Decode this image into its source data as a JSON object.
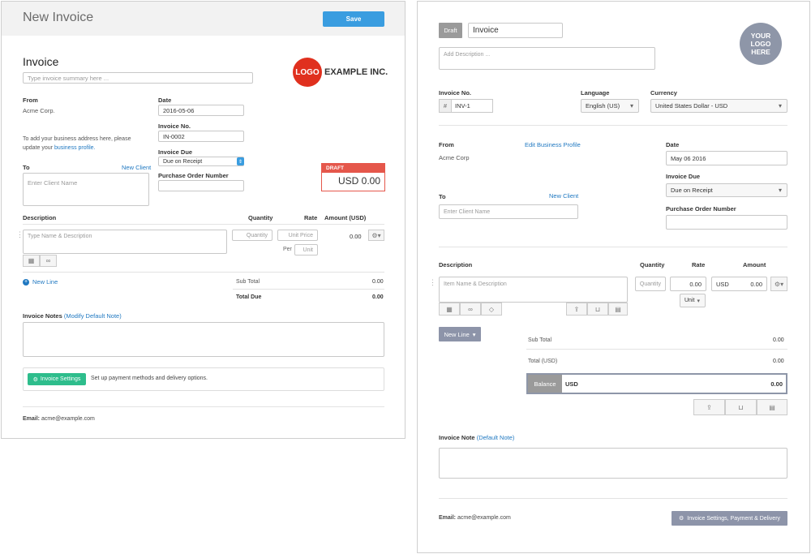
{
  "left": {
    "header_title": "New Invoice",
    "save_label": "Save",
    "invoice_title": "Invoice",
    "summary_placeholder": "Type invoice summary here ...",
    "logo_text": "LOGO",
    "company_name": "EXAMPLE INC.",
    "from_label": "From",
    "from_value": "Acme Corp.",
    "address_note_1": "To add your business address here, please",
    "address_note_2": "update your",
    "business_profile_link": "business profile.",
    "date_label": "Date",
    "date_value": "2016-05-06",
    "invoice_no_label": "Invoice No.",
    "invoice_no_value": "IN-0002",
    "invoice_due_label": "Invoice Due",
    "invoice_due_value": "Due on Receipt",
    "po_label": "Purchase Order Number",
    "to_label": "To",
    "new_client_link": "New Client",
    "client_placeholder": "Enter Client Name",
    "status_badge": "DRAFT",
    "status_amount": "USD 0.00",
    "col_description": "Description",
    "col_quantity": "Quantity",
    "col_rate": "Rate",
    "col_amount": "Amount (USD)",
    "item_placeholder": "Type Name & Description",
    "qty_placeholder": "Quantity",
    "price_placeholder": "Unit Price",
    "per_label": "Per",
    "unit_placeholder": "Unit",
    "line_amount": "0.00",
    "new_line_label": "New Line",
    "subtotal_label": "Sub Total",
    "subtotal_value": "0.00",
    "total_due_label": "Total Due",
    "total_due_value": "0.00",
    "notes_label": "Invoice Notes",
    "modify_note_link": "Modify Default Note",
    "settings_button": "Invoice Settings",
    "settings_desc": "Set up payment methods and delivery options.",
    "email_label": "Email:",
    "email_value": "acme@example.com"
  },
  "right": {
    "draft_badge": "Draft",
    "title_value": "Invoice",
    "description_placeholder": "Add Description ...",
    "logo_text": "YOUR LOGO HERE",
    "invoice_no_label": "Invoice No.",
    "invoice_no_prefix": "#",
    "invoice_no_value": "INV-1",
    "language_label": "Language",
    "language_value": "English (US)",
    "currency_label": "Currency",
    "currency_value": "United States Dollar - USD",
    "from_label": "From",
    "from_value": "Acme Corp",
    "edit_profile_link": "Edit Business Profile",
    "date_label": "Date",
    "date_value": "May 06 2016",
    "invoice_due_label": "Invoice Due",
    "invoice_due_value": "Due on Receipt",
    "po_label": "Purchase Order Number",
    "to_label": "To",
    "new_client_link": "New Client",
    "client_placeholder": "Enter Client Name",
    "col_description": "Description",
    "col_quantity": "Quantity",
    "col_rate": "Rate",
    "col_amount": "Amount",
    "item_placeholder": "Item Name & Description",
    "qty_placeholder": "Quantity",
    "rate_value": "0.00",
    "amount_currency": "USD",
    "amount_value": "0.00",
    "unit_label": "Unit",
    "new_line_label": "New Line",
    "subtotal_label": "Sub Total",
    "subtotal_value": "0.00",
    "total_label": "Total (USD)",
    "total_value": "0.00",
    "balance_label": "Balance",
    "balance_currency": "USD",
    "balance_value": "0.00",
    "note_label": "Invoice Note",
    "default_note_link": "Default Note",
    "email_label": "Email:",
    "email_value": "acme@example.com",
    "settings_button": "Invoice Settings, Payment & Delivery"
  },
  "colors": {
    "save_blue": "#3a9de0",
    "logo_red": "#e0301e",
    "draft_red": "#e5574b",
    "settings_green": "#2ebd8c",
    "right_button_gray": "#8d94a9",
    "logo_circle": "#8e96a8"
  }
}
